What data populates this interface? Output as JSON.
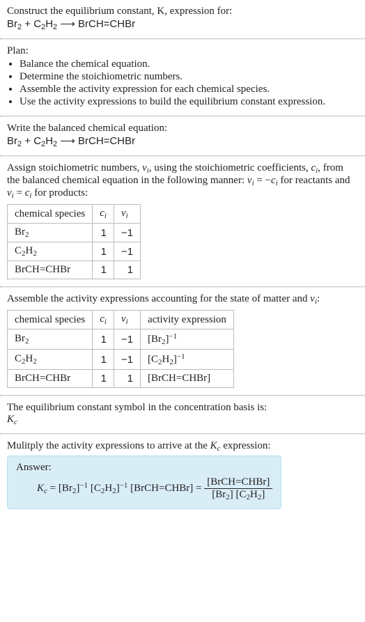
{
  "intro": {
    "line": "Construct the equilibrium constant, K, expression for:",
    "equation_html": "Br<span class='sub'>2</span> + C<span class='sub'>2</span>H<span class='sub'>2</span> <span class='arrow'>⟶</span> BrCH=CHBr"
  },
  "plan": {
    "heading": "Plan:",
    "items": [
      "Balance the chemical equation.",
      "Determine the stoichiometric numbers.",
      "Assemble the activity expression for each chemical species.",
      "Use the activity expressions to build the equilibrium constant expression."
    ]
  },
  "balanced": {
    "heading": "Write the balanced chemical equation:",
    "equation_html": "Br<span class='sub'>2</span> + C<span class='sub'>2</span>H<span class='sub'>2</span> <span class='arrow'>⟶</span> BrCH=CHBr"
  },
  "stoich": {
    "intro_html": "Assign stoichiometric numbers, <span class='ital'>ν<span class='sub'>i</span></span>, using the stoichiometric coefficients, <span class='ital'>c<span class='sub'>i</span></span>, from the balanced chemical equation in the following manner: <span class='ital'>ν<span class='sub'>i</span></span> = −<span class='ital'>c<span class='sub'>i</span></span> for reactants and <span class='ital'>ν<span class='sub'>i</span></span> = <span class='ital'>c<span class='sub'>i</span></span> for products:",
    "headers": {
      "species": "chemical species",
      "ci_html": "<span class='ital'>c<span class='sub'>i</span></span>",
      "vi_html": "<span class='ital'>ν<span class='sub'>i</span></span>"
    },
    "rows": [
      {
        "species_html": "Br<span class='sub'>2</span>",
        "ci": "1",
        "vi": "−1"
      },
      {
        "species_html": "C<span class='sub'>2</span>H<span class='sub'>2</span>",
        "ci": "1",
        "vi": "−1"
      },
      {
        "species_html": "BrCH=CHBr",
        "ci": "1",
        "vi": "1"
      }
    ]
  },
  "activity": {
    "intro_html": "Assemble the activity expressions accounting for the state of matter and <span class='ital'>ν<span class='sub'>i</span></span>:",
    "headers": {
      "species": "chemical species",
      "ci_html": "<span class='ital'>c<span class='sub'>i</span></span>",
      "vi_html": "<span class='ital'>ν<span class='sub'>i</span></span>",
      "act": "activity expression"
    },
    "rows": [
      {
        "species_html": "Br<span class='sub'>2</span>",
        "ci": "1",
        "vi": "−1",
        "act_html": "[Br<span class='sub'>2</span>]<span class='sup'>−1</span>"
      },
      {
        "species_html": "C<span class='sub'>2</span>H<span class='sub'>2</span>",
        "ci": "1",
        "vi": "−1",
        "act_html": "[C<span class='sub'>2</span>H<span class='sub'>2</span>]<span class='sup'>−1</span>"
      },
      {
        "species_html": "BrCH=CHBr",
        "ci": "1",
        "vi": "1",
        "act_html": "[BrCH=CHBr]"
      }
    ]
  },
  "symbol": {
    "line": "The equilibrium constant symbol in the concentration basis is:",
    "sym_html": "<span class='ital'>K<span class='sub'>c</span></span>"
  },
  "multiply": {
    "line_html": "Mulitply the activity expressions to arrive at the <span class='ital'>K<span class='sub'>c</span></span> expression:"
  },
  "answer": {
    "label": "Answer:",
    "lhs_html": "<span class='ital'>K<span class='sub'>c</span></span> = [Br<span class='sub'>2</span>]<span class='sup'>−1</span> [C<span class='sub'>2</span>H<span class='sub'>2</span>]<span class='sup'>−1</span> [BrCH=CHBr] = ",
    "frac_top_html": "[BrCH=CHBr]",
    "frac_bot_html": "[Br<span class='sub'>2</span>] [C<span class='sub'>2</span>H<span class='sub'>2</span>]"
  }
}
